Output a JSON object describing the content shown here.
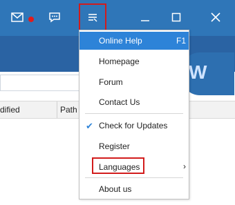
{
  "titlebar": {
    "icons": [
      "mail-icon",
      "chat-icon",
      "menu-icon",
      "minimize-icon",
      "maximize-icon",
      "close-icon"
    ],
    "accent": "#2f76b8"
  },
  "avatar": {
    "letter": "W"
  },
  "table": {
    "headers": [
      "dified",
      "Path"
    ]
  },
  "menu": {
    "items": [
      {
        "label": "Online Help",
        "shortcut": "F1",
        "active": true
      },
      {
        "label": "Homepage"
      },
      {
        "label": "Forum"
      },
      {
        "label": "Contact Us"
      },
      {
        "label": "Check for Updates",
        "checked": true
      },
      {
        "label": "Register"
      },
      {
        "label": "Languages",
        "submenu": true
      },
      {
        "label": "About us"
      }
    ],
    "highlight_color": "#2d83d8"
  }
}
